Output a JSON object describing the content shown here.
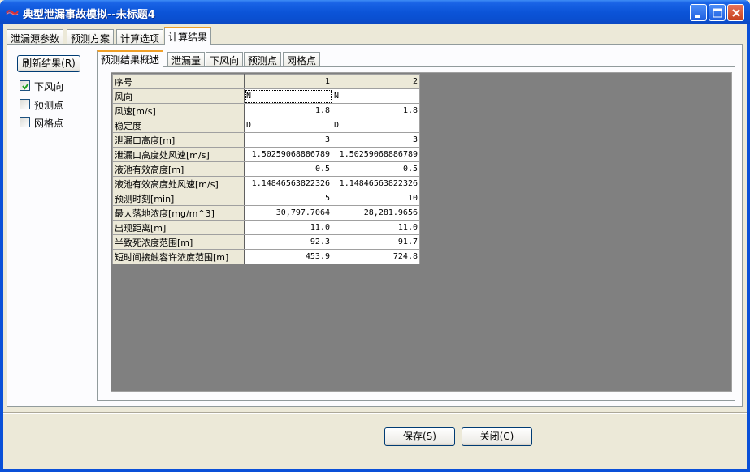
{
  "window": {
    "title": "典型泄漏事故模拟--未标题4"
  },
  "top_tabs": [
    {
      "label": "泄漏源参数"
    },
    {
      "label": "预测方案"
    },
    {
      "label": "计算选项"
    },
    {
      "label": "计算结果"
    }
  ],
  "left_panel": {
    "refresh_label": "刷新结果(R)",
    "checkboxes": [
      {
        "label": "下风向",
        "checked": true
      },
      {
        "label": "预测点",
        "checked": false
      },
      {
        "label": "网格点",
        "checked": false
      }
    ]
  },
  "inner_tabs": [
    {
      "label": "预测结果概述"
    },
    {
      "label": "泄漏量"
    },
    {
      "label": "下风向"
    },
    {
      "label": "预测点"
    },
    {
      "label": "网格点"
    }
  ],
  "results_table": {
    "rows": [
      {
        "label": "序号",
        "v1": "1",
        "v2": "2"
      },
      {
        "label": "风向",
        "v1": "N",
        "v2": "N"
      },
      {
        "label": "风速[m/s]",
        "v1": "1.8",
        "v2": "1.8"
      },
      {
        "label": "稳定度",
        "v1": "D",
        "v2": "D"
      },
      {
        "label": "泄漏口高度[m]",
        "v1": "3",
        "v2": "3"
      },
      {
        "label": "泄漏口高度处风速[m/s]",
        "v1": "1.50259068886789",
        "v2": "1.50259068886789"
      },
      {
        "label": "液池有效高度[m]",
        "v1": "0.5",
        "v2": "0.5"
      },
      {
        "label": "液池有效高度处风速[m/s]",
        "v1": "1.14846563822326",
        "v2": "1.14846563822326"
      },
      {
        "label": "预测时刻[min]",
        "v1": "5",
        "v2": "10"
      },
      {
        "label": "最大落地浓度[mg/m^3]",
        "v1": "30,797.7064",
        "v2": "28,281.9656"
      },
      {
        "label": "出现距离[m]",
        "v1": "11.0",
        "v2": "11.0"
      },
      {
        "label": "半致死浓度范围[m]",
        "v1": "92.3",
        "v2": "91.7"
      },
      {
        "label": "短时间接触容许浓度范围[m]",
        "v1": "453.9",
        "v2": "724.8"
      }
    ]
  },
  "buttons": {
    "save_label": "保存(S)",
    "close_label": "关闭(C)"
  },
  "colors": {
    "titlebar": "#0a50d8",
    "grid_background": "#808080",
    "active_tab_accent": "#f0a028"
  }
}
